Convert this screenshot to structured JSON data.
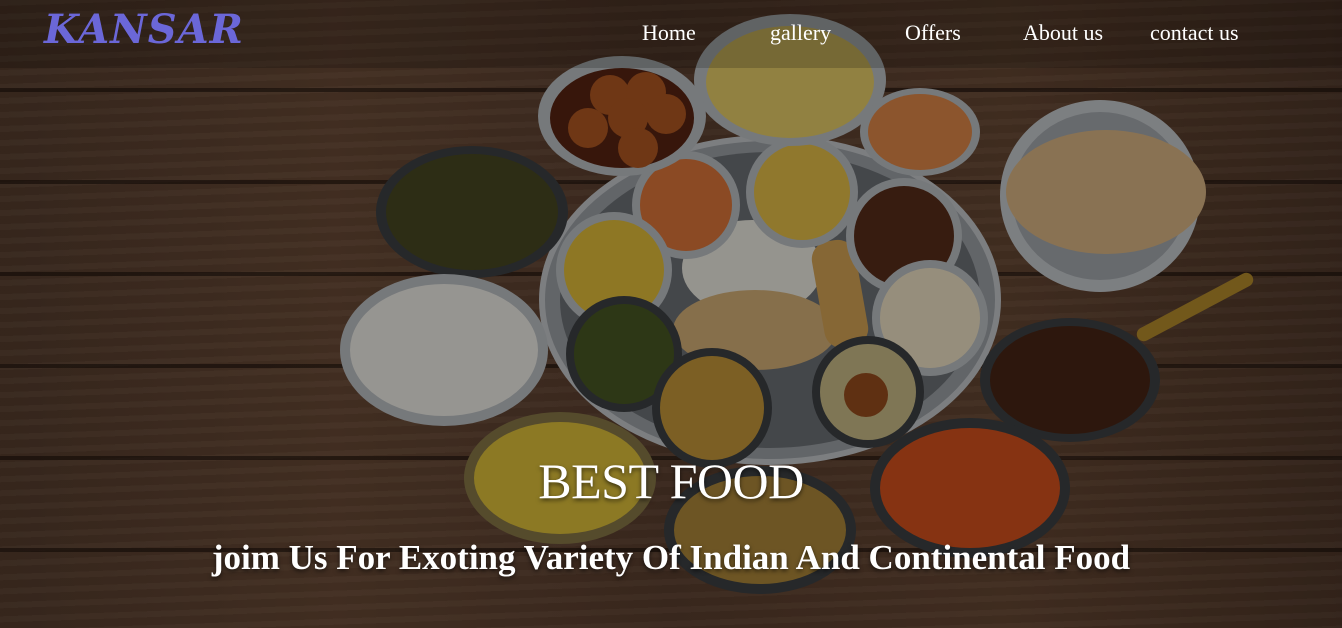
{
  "brand": {
    "logo_text": "KANSAR"
  },
  "nav": {
    "home": "Home",
    "gallery": "gallery",
    "offers": "Offers",
    "about": "About us",
    "contact": "contact us"
  },
  "hero": {
    "title": "BEST FOOD",
    "subtitle": "joim Us For Exoting Variety Of Indian And Continental Food",
    "image": "indian-thali-food-photo"
  },
  "colors": {
    "logo": "#6b67d8",
    "nav_text": "#ffffff",
    "hero_text": "#ffffff",
    "wood": "#5f4231"
  }
}
